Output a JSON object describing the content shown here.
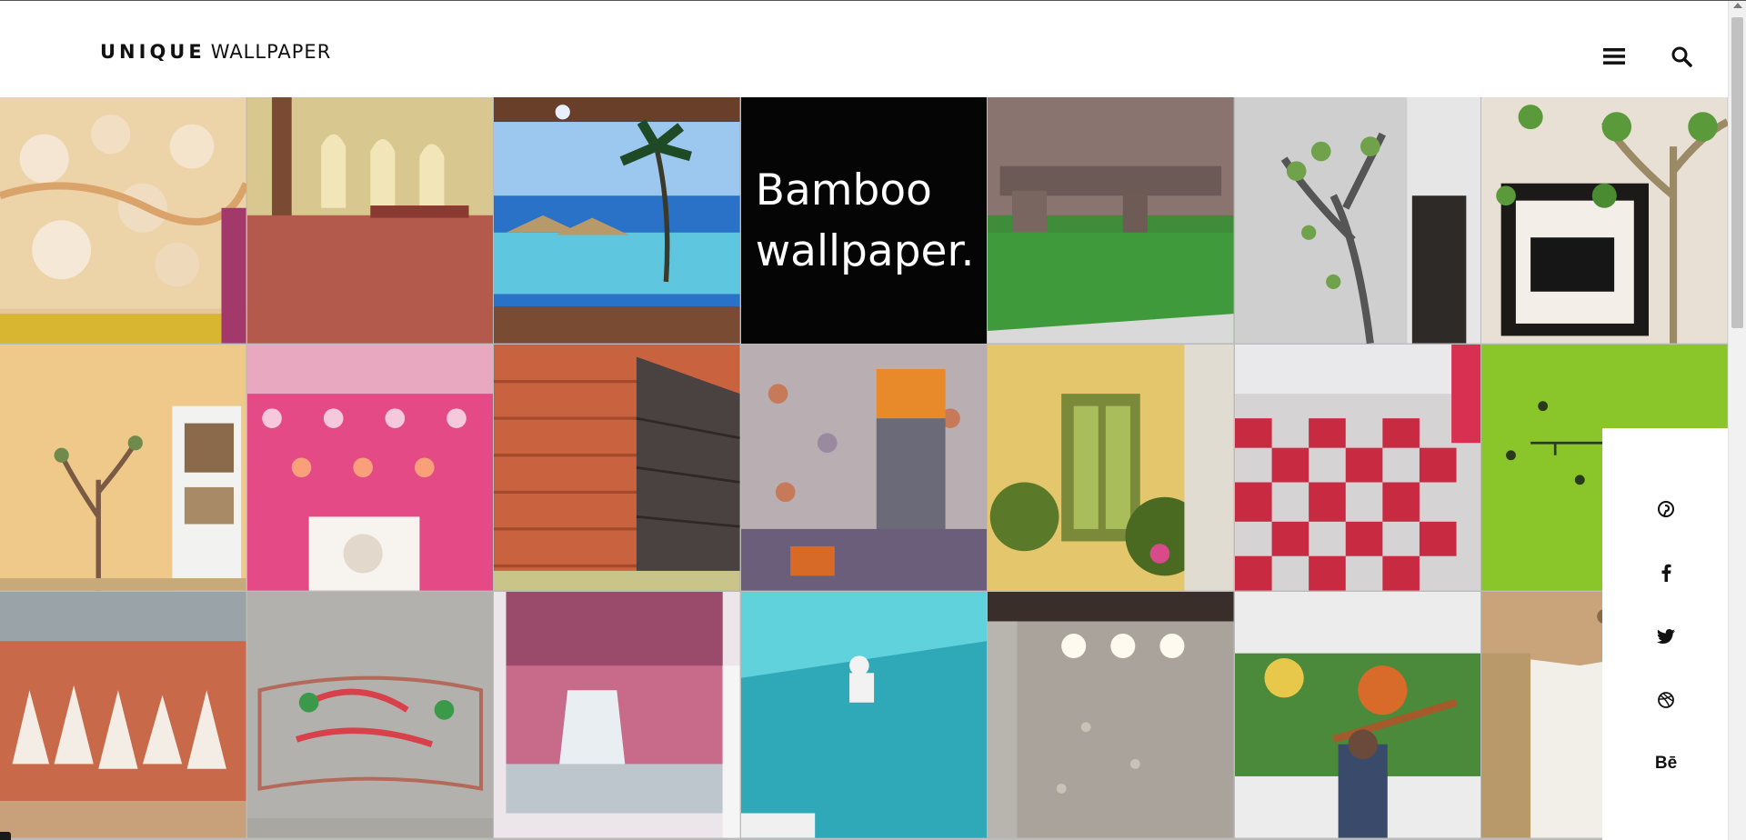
{
  "header": {
    "logo_bold": "UNIQUE",
    "logo_light": "WALLPAPER",
    "menu_icon": "hamburger-menu-icon",
    "search_icon": "search-icon"
  },
  "featured": {
    "title": "Bamboo wallpaper."
  },
  "gallery": {
    "tiles": [
      "3d-flower-wallpaper-photo",
      "hall-red-carpet-photo",
      "beach-palm-mural-photo",
      "bamboo-wallpaper-title",
      "artificial-grass-photo",
      "tree-wall-decal-photo",
      "tree-tv-wall-photo",
      "tree-decal-shelf-photo",
      "pink-damask-wallpaper-photo",
      "brick-wallpaper-photo",
      "floral-wallpaper-curtain-photo",
      "garden-door-mural-photo",
      "checkered-floor-photo",
      "green-wall-decal-photo",
      "horses-mural-photo",
      "name-wall-art-photo",
      "waterfall-mural-photo",
      "teal-carpet-photo",
      "damask-wall-spotlights-photo",
      "nature-mural-install-photo",
      "ceiling-wallpaper-photo"
    ]
  },
  "social": {
    "pinterest": "pinterest-icon",
    "facebook": "facebook-icon",
    "twitter": "twitter-icon",
    "dribbble": "dribbble-icon",
    "behance_label": "Bē"
  },
  "colors": {
    "title_bg": "#050505",
    "text": "#111111"
  }
}
